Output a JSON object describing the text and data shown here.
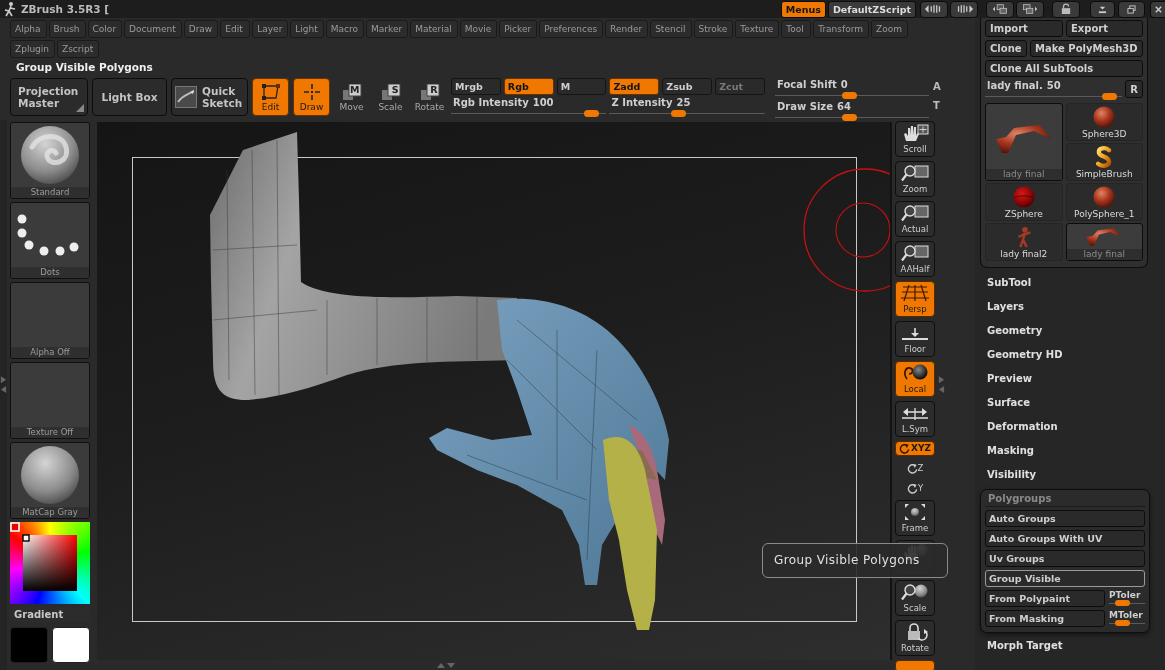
{
  "title_bar": {
    "app_title": "ZBrush 3.5R3 [",
    "buttons": [
      {
        "label": "Menus",
        "selected": true
      },
      {
        "label": "DefaultZScript",
        "selected": false
      }
    ]
  },
  "menu_bar": {
    "rows": [
      [
        "Alpha",
        "Brush",
        "Color",
        "Document",
        "Draw",
        "Edit",
        "Layer",
        "Light",
        "Macro",
        "Marker",
        "Material",
        "Movie",
        "Picker",
        "Preferences",
        "Render",
        "Stencil",
        "Stroke",
        "Texture",
        "Tool",
        "Transform",
        "Zoom"
      ],
      [
        "Zplugin",
        "Zscript"
      ]
    ]
  },
  "status_text": "Group Visible Polygons",
  "toolbar": {
    "buttons": [
      {
        "label": "Projection Master",
        "kind": "menu"
      },
      {
        "label": "Light Box",
        "kind": "plain"
      },
      {
        "label": "Quick Sketch",
        "kind": "sketch"
      }
    ],
    "modes": [
      {
        "label": "Edit",
        "kind": "edit",
        "selected": true
      },
      {
        "label": "Draw",
        "kind": "draw",
        "selected": true
      },
      {
        "label": "Move",
        "key": "M",
        "kind": "transform",
        "selected": false
      },
      {
        "label": "Scale",
        "key": "S",
        "kind": "transform",
        "selected": false
      },
      {
        "label": "Rotate",
        "key": "R",
        "kind": "transform",
        "selected": false
      }
    ],
    "toggles": [
      {
        "label": "Mrgb",
        "selected": false,
        "disabled": false
      },
      {
        "label": "Rgb",
        "selected": true,
        "disabled": false
      },
      {
        "label": "M",
        "selected": false,
        "disabled": false
      },
      {
        "label": "Zadd",
        "selected": true,
        "disabled": false
      },
      {
        "label": "Zsub",
        "selected": false,
        "disabled": false
      },
      {
        "label": "Zcut",
        "selected": false,
        "disabled": true
      }
    ],
    "sliders": [
      {
        "label": "Rgb Intensity",
        "reading": "100",
        "level": 0.95
      },
      {
        "label": "Z Intensity",
        "reading": "25",
        "level": 0.44
      },
      {
        "label": "Focal Shift",
        "reading": "0",
        "level": 0.48
      },
      {
        "label": "Draw Size",
        "reading": "64",
        "level": 0.48
      }
    ],
    "cut_labels": [
      "A",
      "T"
    ]
  },
  "left_shelf": {
    "tiles": [
      {
        "label": "Standard",
        "kind": "brush"
      },
      {
        "label": "Dots",
        "kind": "stroke"
      },
      {
        "label": "Alpha Off",
        "kind": "alpha"
      },
      {
        "label": "Texture Off",
        "kind": "texture"
      },
      {
        "label": "MatCap Gray",
        "kind": "material"
      }
    ],
    "gradient_label": "Gradient",
    "swatches": [
      {
        "color": "#000000"
      },
      {
        "color": "#ffffff"
      }
    ]
  },
  "canvas": {
    "tooltip": "Group Visible Polygons"
  },
  "view_toolbar": [
    {
      "label": "Scroll",
      "kind": "scroll",
      "selected": false
    },
    {
      "label": "Zoom",
      "kind": "zoom",
      "selected": false
    },
    {
      "label": "Actual",
      "kind": "actual",
      "selected": false
    },
    {
      "label": "AAHalf",
      "kind": "aahalf",
      "selected": false
    },
    {
      "label": "Persp",
      "kind": "persp",
      "selected": true
    },
    {
      "label": "Floor",
      "kind": "floor",
      "selected": false
    },
    {
      "label": "Local",
      "kind": "local",
      "selected": true
    },
    {
      "label": "L.Sym",
      "kind": "lsym",
      "selected": false
    },
    {
      "label": "XYZ",
      "kind": "xyz",
      "selected": true
    },
    {
      "label": "Z",
      "kind": "axis",
      "selected": false
    },
    {
      "label": "Y",
      "kind": "axis",
      "selected": false
    },
    {
      "label": "Frame",
      "kind": "frame",
      "selected": false
    },
    {
      "kind": "move",
      "selected": false
    },
    {
      "label": "Scale",
      "kind": "scale",
      "selected": false
    },
    {
      "label": "Rotate",
      "kind": "rotate",
      "selected": false
    },
    {
      "kind": "stub",
      "selected": true
    }
  ],
  "tool_palette": {
    "rows": [
      [
        {
          "label": "Import"
        },
        {
          "label": "Export"
        }
      ],
      [
        {
          "label": "Clone"
        },
        {
          "label": "Make PolyMesh3D"
        }
      ],
      [
        {
          "label": "Clone All SubTools"
        }
      ]
    ],
    "slider": {
      "label": "lady final.",
      "reading": "50",
      "level": 0.96
    },
    "reset_label": "R",
    "current_tool": {
      "label": "lady final",
      "kind": "arm"
    },
    "tools": [
      {
        "label": "Sphere3D",
        "kind": "sphere",
        "selected": false
      },
      {
        "label": "SimpleBrush",
        "kind": "brush",
        "selected": false
      },
      {
        "label": "ZSphere",
        "kind": "zsphere",
        "selected": false
      },
      {
        "label": "PolySphere_1",
        "kind": "sphere",
        "selected": false
      },
      {
        "label": "lady final2",
        "kind": "figure",
        "selected": false
      },
      {
        "label": "lady final",
        "kind": "arm",
        "selected": true
      }
    ]
  },
  "sections": [
    {
      "label": "SubTool",
      "kind": "header"
    },
    {
      "label": "Layers",
      "kind": "header"
    },
    {
      "label": "Geometry",
      "kind": "header"
    },
    {
      "label": "Geometry HD",
      "kind": "header"
    },
    {
      "label": "Preview",
      "kind": "header"
    },
    {
      "label": "Surface",
      "kind": "header"
    },
    {
      "label": "Deformation",
      "kind": "header"
    },
    {
      "label": "Masking",
      "kind": "header"
    },
    {
      "label": "Visibility",
      "kind": "header"
    },
    {
      "label": "Polygroups",
      "kind": "panel",
      "buttons": [
        {
          "label": "Auto Groups",
          "selected": false
        },
        {
          "label": "Auto Groups With UV",
          "selected": false
        },
        {
          "label": "Uv Groups",
          "selected": false
        },
        {
          "label": "Group Visible",
          "selected": true
        },
        {
          "label": "From Polypaint",
          "selected": false,
          "slider": {
            "label": "PToler",
            "level": 0.3
          }
        },
        {
          "label": "From Masking",
          "selected": false,
          "slider": {
            "label": "MToler",
            "level": 0.3
          }
        }
      ]
    },
    {
      "label": "Morph Target",
      "kind": "header"
    }
  ]
}
